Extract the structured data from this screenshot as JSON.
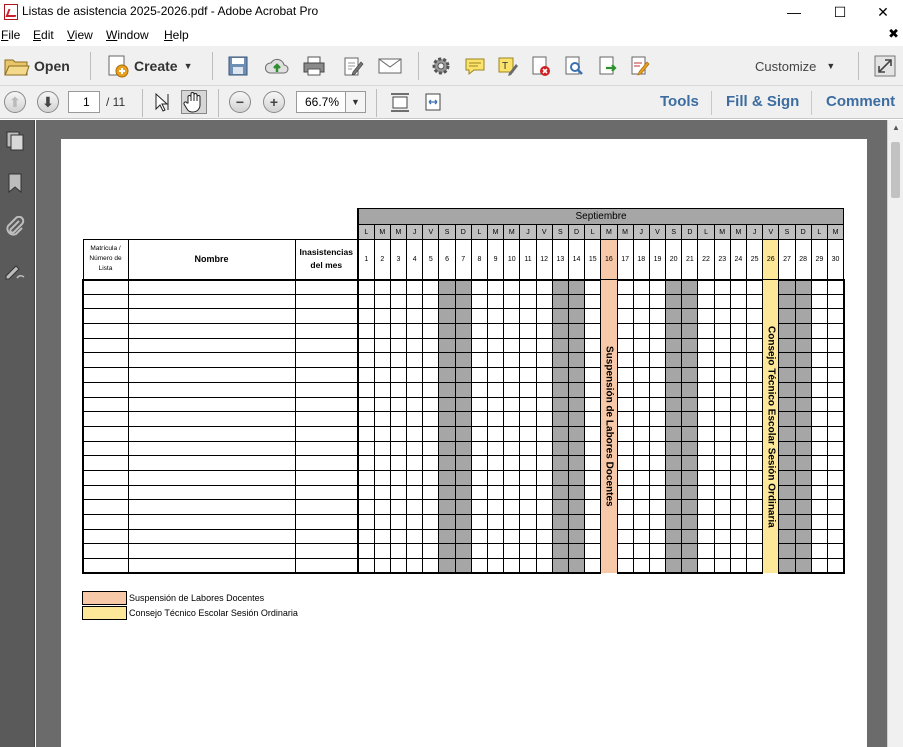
{
  "window": {
    "title": "Listas de asistencia 2025-2026.pdf - Adobe Acrobat Pro",
    "minimize": "—",
    "maximize": "☐",
    "close": "✕"
  },
  "menu": {
    "items": [
      "File",
      "Edit",
      "View",
      "Window",
      "Help"
    ],
    "close_doc": "✖"
  },
  "toolbar": {
    "open_label": "Open",
    "create_label": "Create",
    "customize_label": "Customize",
    "icons": [
      "folder-icon",
      "create-pdf-icon",
      "save-icon",
      "cloud-upload-icon",
      "print-icon",
      "edit-icon",
      "email-icon",
      "gear-icon",
      "comment-icon",
      "highlight-icon",
      "delete-icon",
      "search-doc-icon",
      "export-icon",
      "sign-icon",
      "expand-icon"
    ]
  },
  "nav": {
    "current_page": "1",
    "total_pages": "/ 11",
    "zoom": "66.7%",
    "tools_label": "Tools",
    "fill_sign_label": "Fill & Sign",
    "comment_label": "Comment"
  },
  "sheet": {
    "month": "Septiembre",
    "col_matricula": "Matrícula / Número de Lista",
    "col_nombre": "Nombre",
    "col_inasistencias": "Inasistencias del mes",
    "days_of_week": [
      "L",
      "M",
      "M",
      "J",
      "V",
      "S",
      "D",
      "L",
      "M",
      "M",
      "J",
      "V",
      "S",
      "D",
      "L",
      "M",
      "M",
      "J",
      "V",
      "S",
      "D",
      "L",
      "M",
      "M",
      "J",
      "V",
      "S",
      "D",
      "L",
      "M"
    ],
    "days": [
      "1",
      "2",
      "3",
      "4",
      "5",
      "6",
      "7",
      "8",
      "9",
      "10",
      "11",
      "12",
      "13",
      "14",
      "15",
      "16",
      "17",
      "18",
      "19",
      "20",
      "21",
      "22",
      "23",
      "24",
      "25",
      "26",
      "27",
      "28",
      "29",
      "30"
    ],
    "weekend_days": [
      6,
      7,
      13,
      14,
      20,
      21,
      27,
      28
    ],
    "suspension_day": 16,
    "cte_day": 26,
    "suspension_text": "Suspensión de Labores Docentes",
    "cte_text": "Consejo Técnico Escolar Sesión Ordinaria",
    "student_rows": 20,
    "suspension_color": "#f8c9a9",
    "cte_color": "#fde89a",
    "weekend_color": "#a6a6a6"
  },
  "legend": [
    {
      "label": "Suspensión de Labores Docentes",
      "color": "#f8c9a9"
    },
    {
      "label": "Consejo Técnico Escolar Sesión Ordinaria",
      "color": "#fde89a"
    }
  ]
}
